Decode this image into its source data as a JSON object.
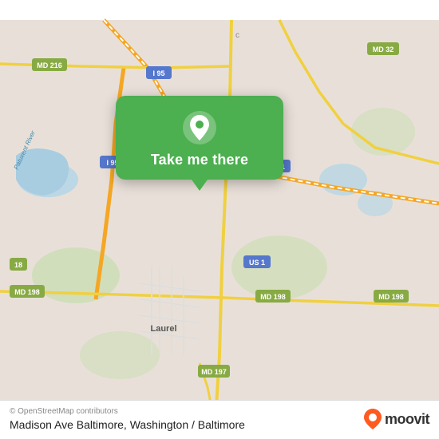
{
  "map": {
    "alt": "Map of Laurel area, Washington/Baltimore region"
  },
  "popup": {
    "label": "Take me there",
    "pin_icon": "location-pin"
  },
  "bottom_bar": {
    "copyright": "© OpenStreetMap contributors",
    "location": "Madison Ave Baltimore, Washington / Baltimore"
  },
  "moovit": {
    "text": "moovit"
  },
  "road_labels": {
    "i195_top": "I 95",
    "i195_left": "I 95",
    "us1_right": "US 1",
    "us1_bottom": "US 1",
    "md216": "MD 216",
    "md32": "MD 32",
    "md198_left": "MD 198",
    "md198_right1": "MD 198",
    "md198_right2": "MD 198",
    "md197": "MD 197",
    "md18": "18",
    "laurel": "Laurel",
    "patuxent": "Patuxent River"
  }
}
